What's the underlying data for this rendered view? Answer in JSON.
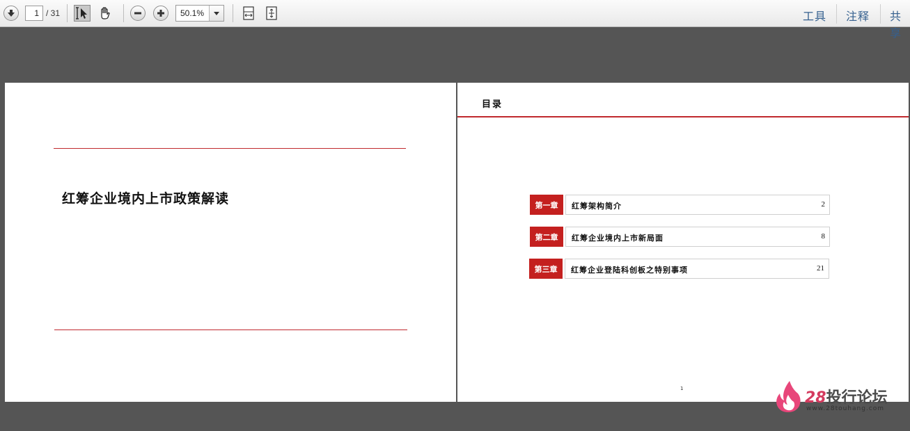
{
  "toolbar": {
    "page_current": "1",
    "page_total": "/ 31",
    "zoom": "50.1%",
    "links": [
      "工具",
      "注释",
      "共享"
    ]
  },
  "page1": {
    "title": "红筹企业境内上市政策解读"
  },
  "page2": {
    "heading": "目录",
    "toc": [
      {
        "chapter": "第一章",
        "title": "红筹架构简介",
        "page": "2"
      },
      {
        "chapter": "第二章",
        "title": "红筹企业境内上市新局面",
        "page": "8"
      },
      {
        "chapter": "第三章",
        "title": "红筹企业登陆科创板之特别事项",
        "page": "21"
      }
    ],
    "footer_page": "1"
  },
  "watermark": {
    "brand_num": "28",
    "brand_text": "投行论坛",
    "url": "www.28touhang.com"
  },
  "colors": {
    "accent_red": "#c4201f",
    "toolbar_link": "#35608f"
  }
}
